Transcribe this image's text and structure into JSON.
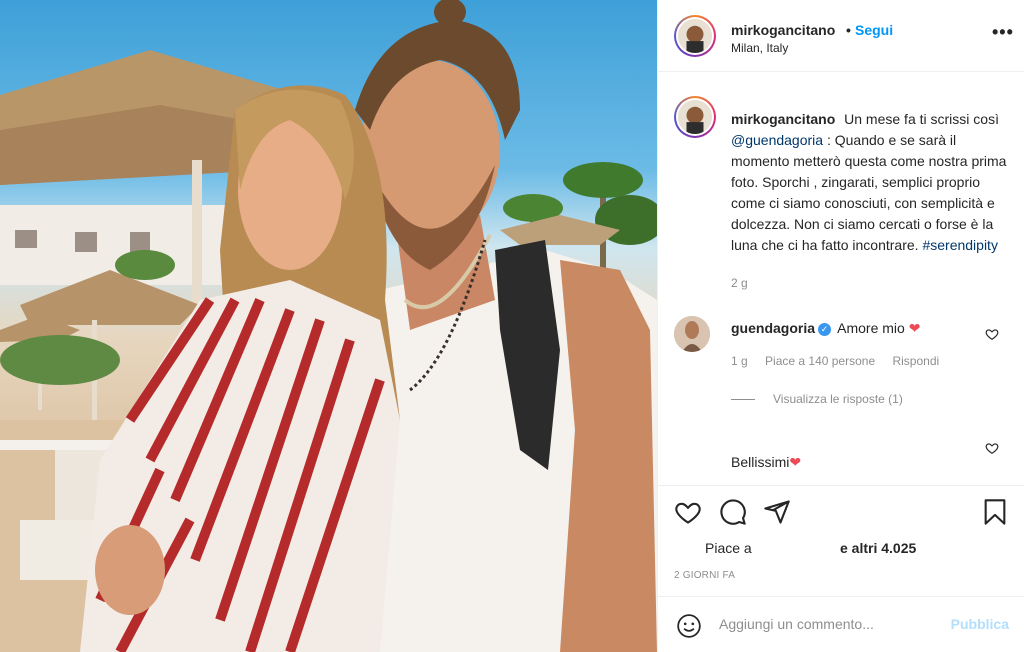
{
  "post": {
    "username": "mirkogancitano",
    "dot": "•",
    "follow_label": "Segui",
    "location": "Milan, Italy",
    "more_label": "•••"
  },
  "caption": {
    "username": "mirkogancitano",
    "text_before": "Un mese fa ti scrissi così",
    "mention": "@guendagoria",
    "text_after": ": Quando e se sarà il momento metterò questa come nostra prima foto. Sporchi , zingarati, semplici proprio come ci siamo conosciuti, con semplicità e dolcezza. Non ci siamo cercati o forse è la luna che ci ha fatto incontrare.",
    "hashtag": "#serendipity",
    "time": "2 g"
  },
  "comments": [
    {
      "username": "guendagoria",
      "verified_mark": "✓",
      "text": "Amore mio",
      "heart": "❤",
      "time": "1 g",
      "likes": "Piace a 140 persone",
      "reply_label": "Rispondi",
      "view_replies": "Visualizza le risposte (1)"
    },
    {
      "text": "Bellissimi",
      "heart": "❤"
    }
  ],
  "actions": {
    "like_icon": "heart-outline-icon",
    "comment_icon": "comment-icon",
    "share_icon": "paper-plane-icon",
    "save_icon": "bookmark-icon",
    "likes_prefix": "Piace a",
    "likes_suffix": "e altri 4.025",
    "date": "2 GIORNI FA"
  },
  "add_comment": {
    "placeholder": "Aggiungi un commento...",
    "publish_label": "Pubblica"
  },
  "colors": {
    "link": "#0095f6",
    "mention": "#00376b",
    "muted": "#8e8e8e",
    "publish_disabled": "#b2dffc",
    "heart": "#ed4956"
  }
}
